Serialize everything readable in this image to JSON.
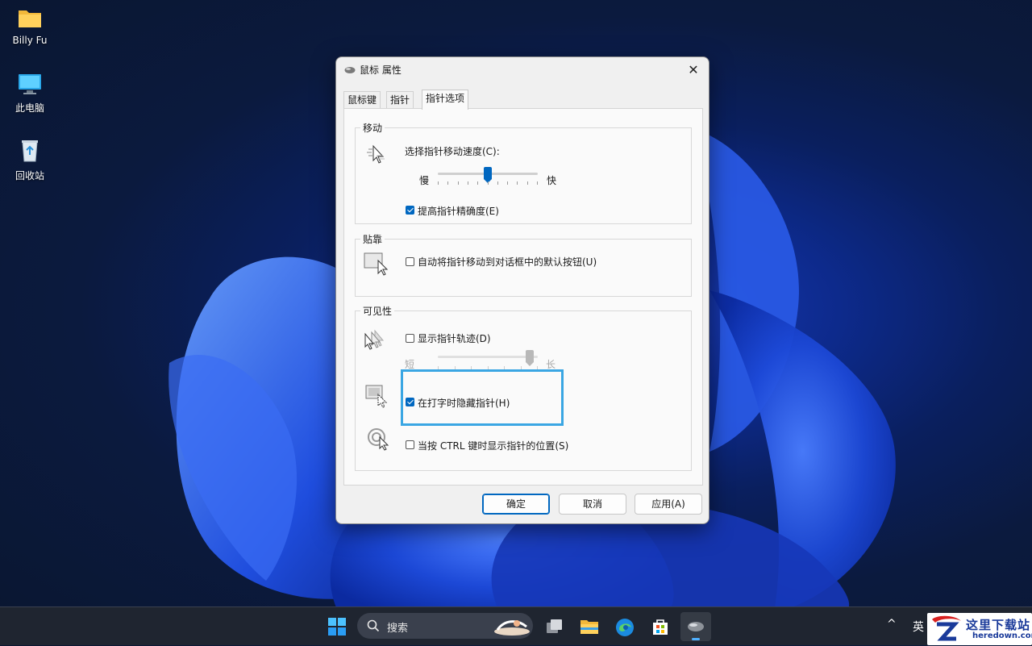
{
  "desktop": {
    "icons": [
      {
        "label": "Billy Fu",
        "icon": "folder-icon"
      },
      {
        "label": "此电脑",
        "icon": "computer-icon"
      },
      {
        "label": "回收站",
        "icon": "recycle-bin-icon"
      }
    ]
  },
  "dialog": {
    "title": "鼠标 属性",
    "tabs": [
      {
        "label": "鼠标键",
        "active": false
      },
      {
        "label": "指针",
        "active": false
      },
      {
        "label": "指针选项",
        "active": true
      }
    ],
    "motion": {
      "group_title": "移动",
      "speed_label": "选择指针移动速度(C):",
      "slow": "慢",
      "fast": "快",
      "speed_value_fraction": 0.5,
      "precision_label": "提高指针精确度(E)",
      "precision_checked": true
    },
    "snap": {
      "group_title": "贴靠",
      "snap_label": "自动将指针移动到对话框中的默认按钮(U)",
      "snap_checked": false
    },
    "visibility": {
      "group_title": "可见性",
      "trails_label": "显示指针轨迹(D)",
      "trails_checked": false,
      "short": "短",
      "long": "长",
      "trails_value_fraction": 0.92,
      "hide_typing_label": "在打字时隐藏指针(H)",
      "hide_typing_checked": true,
      "ctrl_label": "当按 CTRL 键时显示指针的位置(S)",
      "ctrl_checked": false
    },
    "buttons": {
      "ok": "确定",
      "cancel": "取消",
      "apply": "应用(A)"
    }
  },
  "taskbar": {
    "search_label": "搜索",
    "tray_language": "英"
  },
  "watermark": {
    "title": "这里下载站",
    "url": "heredown.com"
  },
  "colors": {
    "accent": "#0067c0",
    "highlight": "#3aa6e3",
    "taskbar": "#1f2530"
  }
}
